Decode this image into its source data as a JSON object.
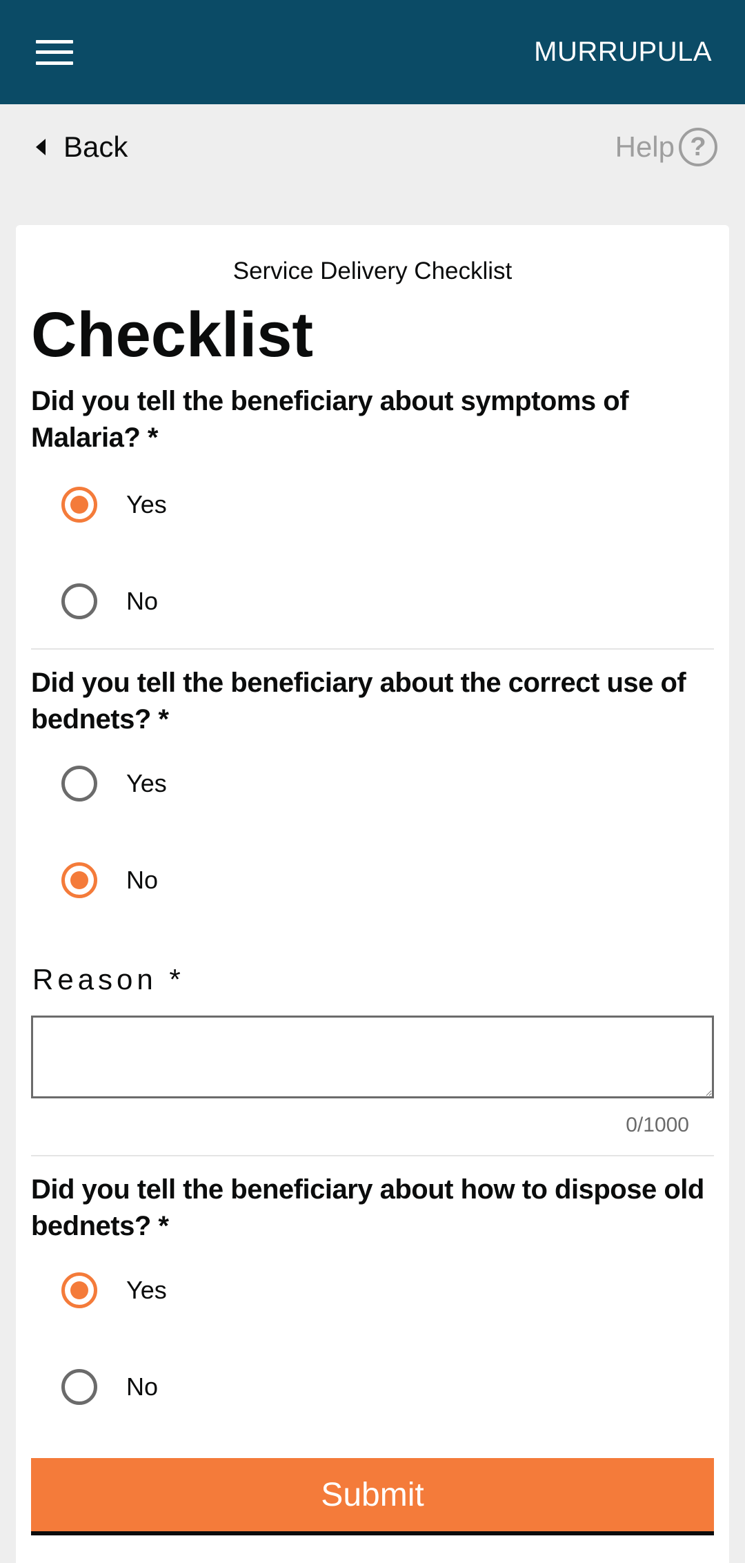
{
  "header": {
    "locality": "MURRUPULA"
  },
  "nav": {
    "back_label": "Back",
    "help_label": "Help",
    "help_glyph": "?"
  },
  "card": {
    "form_name": "Service Delivery Checklist",
    "title": "Checklist"
  },
  "questions": [
    {
      "text": "Did you tell the beneficiary about symptoms of Malaria? *",
      "options": [
        {
          "label": "Yes",
          "selected": true
        },
        {
          "label": "No",
          "selected": false
        }
      ]
    },
    {
      "text": "Did you tell the beneficiary about the correct use of bednets? *",
      "options": [
        {
          "label": "Yes",
          "selected": false
        },
        {
          "label": "No",
          "selected": true
        }
      ],
      "reason": {
        "label": "Reason *",
        "value": "",
        "counter": "0/1000"
      }
    },
    {
      "text": "Did you tell the beneficiary about how to dispose old bednets? *",
      "options": [
        {
          "label": "Yes",
          "selected": true
        },
        {
          "label": "No",
          "selected": false
        }
      ]
    }
  ],
  "submit_label": "Submit",
  "colors": {
    "topbar": "#0b4b66",
    "accent": "#f47b3a",
    "background": "#eeeeee"
  },
  "icons": {
    "menu": "hamburger-menu-icon",
    "back": "caret-left-icon",
    "help": "question-circle-icon"
  }
}
